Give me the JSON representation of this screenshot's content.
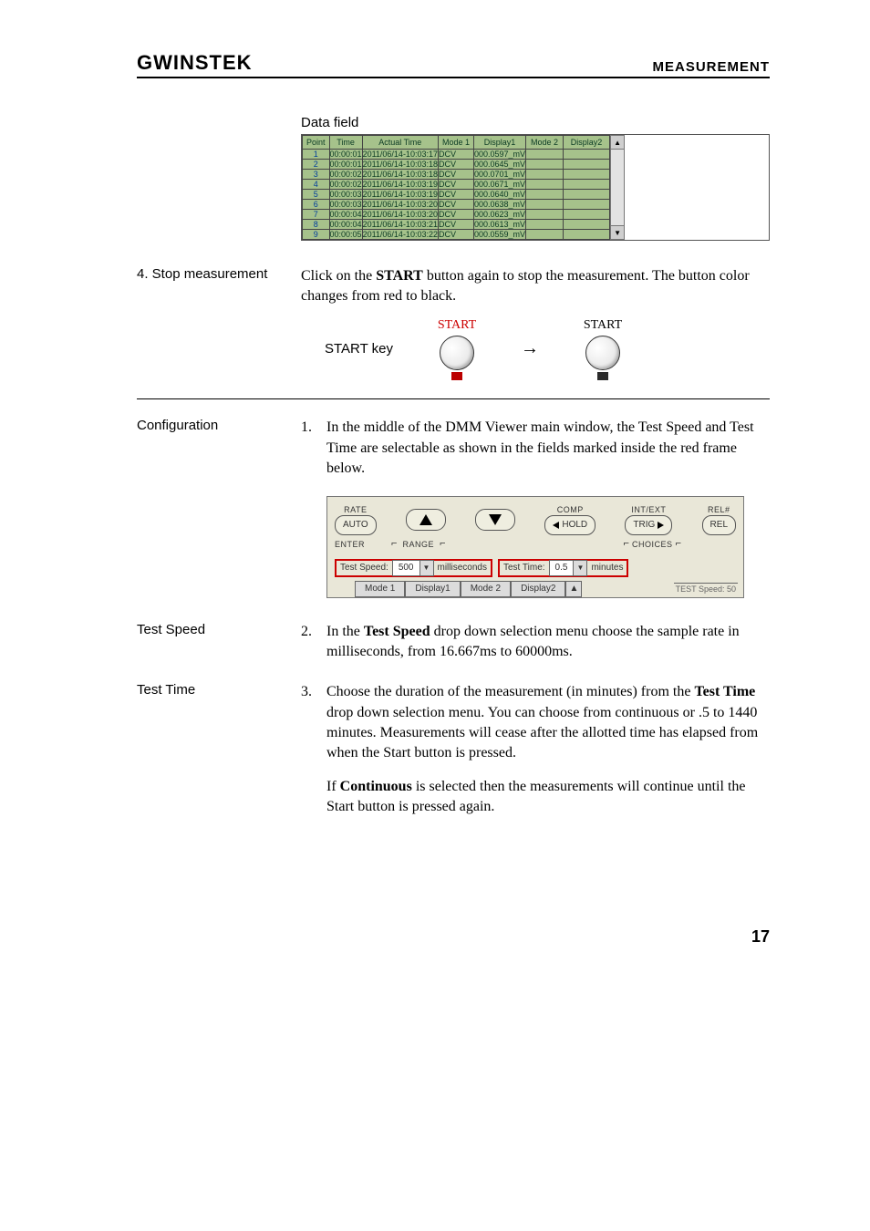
{
  "header": {
    "brand": "GWINSTEK",
    "section": "MEASUREMENT"
  },
  "data_field": {
    "label": "Data field",
    "cols": [
      "Point",
      "Time",
      "Actual Time",
      "Mode 1",
      "Display1",
      "Mode 2",
      "Display2"
    ],
    "rows": [
      {
        "pt": "1",
        "time": "00:00:01",
        "actual": "2011/06/14-10:03:17",
        "m1": "DCV",
        "d1": "000.0597_mV"
      },
      {
        "pt": "2",
        "time": "00:00:01",
        "actual": "2011/06/14-10:03:18",
        "m1": "DCV",
        "d1": "000.0645_mV"
      },
      {
        "pt": "3",
        "time": "00:00:02",
        "actual": "2011/06/14-10:03:18",
        "m1": "DCV",
        "d1": "000.0701_mV"
      },
      {
        "pt": "4",
        "time": "00:00:02",
        "actual": "2011/06/14-10:03:19",
        "m1": "DCV",
        "d1": "000.0671_mV"
      },
      {
        "pt": "5",
        "time": "00:00:03",
        "actual": "2011/06/14-10:03:19",
        "m1": "DCV",
        "d1": "000.0640_mV"
      },
      {
        "pt": "6",
        "time": "00:00:03",
        "actual": "2011/06/14-10:03:20",
        "m1": "DCV",
        "d1": "000.0638_mV"
      },
      {
        "pt": "7",
        "time": "00:00:04",
        "actual": "2011/06/14-10:03:20",
        "m1": "DCV",
        "d1": "000.0623_mV"
      },
      {
        "pt": "8",
        "time": "00:00:04",
        "actual": "2011/06/14-10:03:21",
        "m1": "DCV",
        "d1": "000.0613_mV"
      },
      {
        "pt": "9",
        "time": "00:00:05",
        "actual": "2011/06/14-10:03:22",
        "m1": "DCV",
        "d1": "000.0559_mV"
      }
    ]
  },
  "stop": {
    "heading": "4. Stop measurement",
    "body_pre": "Click on the ",
    "body_bold": "START",
    "body_post": " button again to stop the measurement. The button color changes from red to black.",
    "start_key": "START key",
    "start_red": "START",
    "start_black": "START",
    "arrow": "→"
  },
  "config": {
    "heading": "Configuration",
    "num": "1.",
    "body": "In the middle of the DMM Viewer main window, the Test Speed and Test Time are selectable as shown in the fields marked inside the red frame below.",
    "panel": {
      "rate": "RATE",
      "auto": "AUTO",
      "enter": "ENTER",
      "range": "RANGE",
      "comp": "COMP",
      "hold": "HOLD",
      "intext": "INT/EXT",
      "trig": "TRIG",
      "relhash": "REL#",
      "rel": "REL",
      "choices": "CHOICES",
      "test_speed_lbl": "Test Speed:",
      "test_speed_val": "500",
      "test_speed_unit": "milliseconds",
      "test_time_lbl": "Test Time:",
      "test_time_val": "0.5",
      "test_time_unit": "minutes",
      "mode1": "Mode 1",
      "display1": "Display1",
      "mode2": "Mode 2",
      "display2": "Display2",
      "corner": "TEST Speed: 50"
    }
  },
  "speed": {
    "heading": "Test Speed",
    "num": "2.",
    "b_pre": "In the ",
    "b_bold": "Test Speed",
    "b_post": " drop down selection menu choose the sample rate in milliseconds, from 16.667ms to 60000ms."
  },
  "time": {
    "heading": "Test Time",
    "num": "3.",
    "b_pre": "Choose the duration of the measurement (in minutes) from the ",
    "b_bold": "Test Time",
    "b_post": " drop down selection menu. You can choose from continuous or .5 to 1440 minutes. Measurements will cease after the allotted time has elapsed from when the Start button is pressed.",
    "p2_pre": "If ",
    "p2_bold": "Continuous",
    "p2_post": " is selected then the measurements will continue until the Start button is pressed again."
  },
  "pagenum": "17"
}
